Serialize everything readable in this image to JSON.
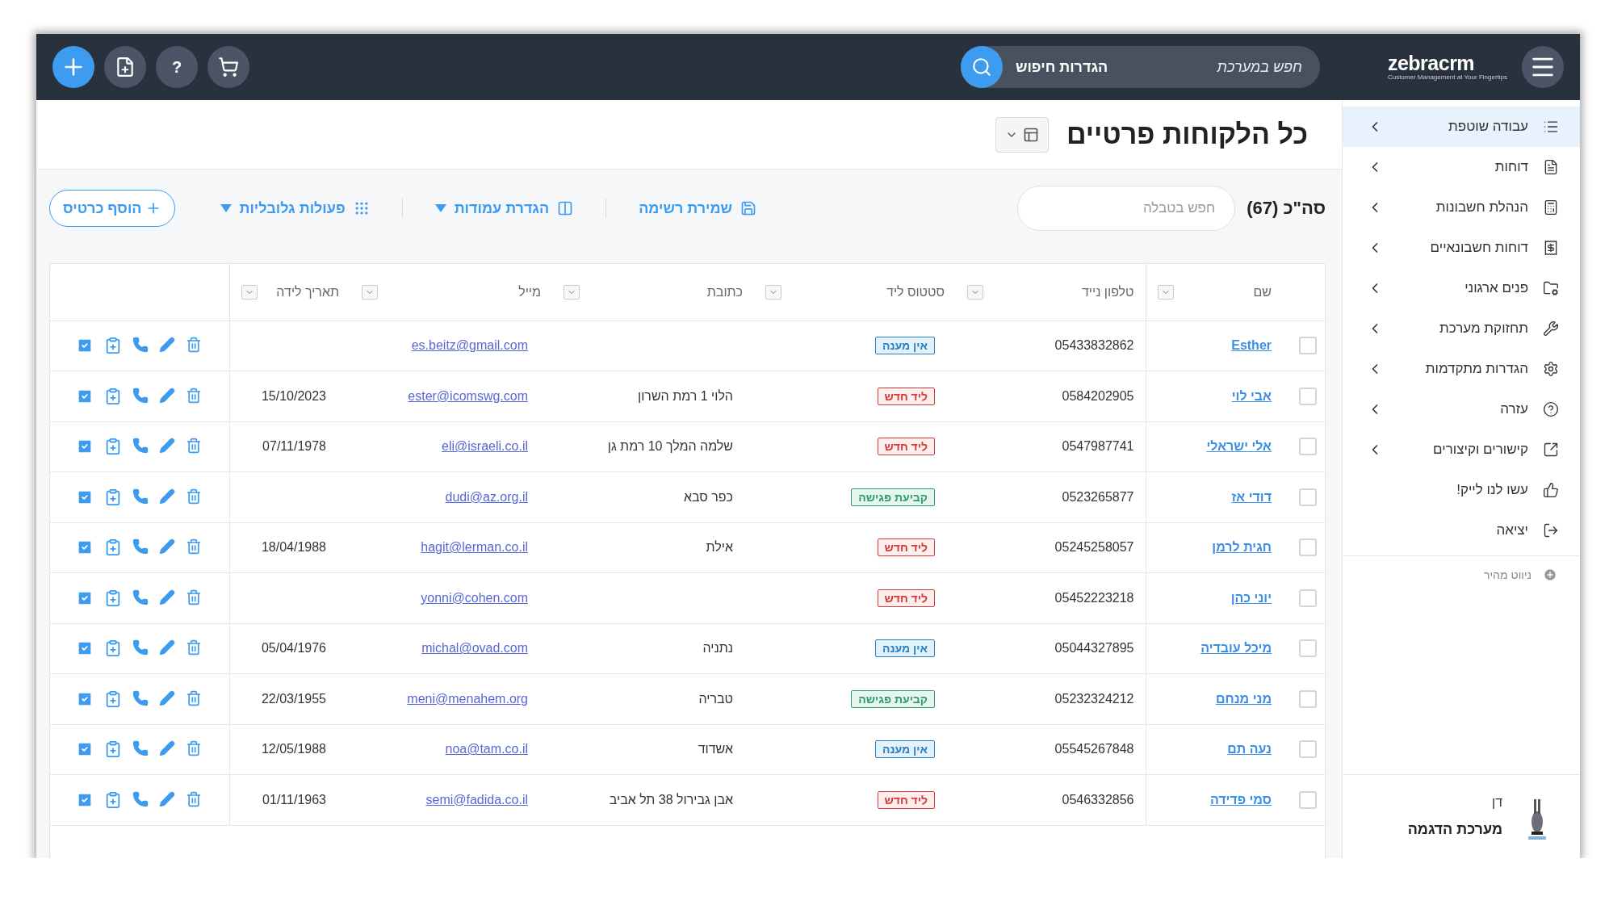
{
  "topbar": {
    "logo": "zebracrm",
    "tagline": "Customer Management at Your Fingertips",
    "search": {
      "placeholder": "חפש במערכת",
      "settings_label": "הגדרות חיפוש"
    },
    "help_button": "?"
  },
  "sidebar": {
    "items": [
      {
        "label": "עבודה שוטפת",
        "selected": true,
        "has_submenu": true
      },
      {
        "label": "דוחות",
        "selected": false,
        "has_submenu": true
      },
      {
        "label": "הנהלת חשבונות",
        "selected": false,
        "has_submenu": true
      },
      {
        "label": "דוחות חשבונאיים",
        "selected": false,
        "has_submenu": true
      },
      {
        "label": "פנים ארגוני",
        "selected": false,
        "has_submenu": true
      },
      {
        "label": "תחזוקת מערכת",
        "selected": false,
        "has_submenu": true
      },
      {
        "label": "הגדרות מתקדמות",
        "selected": false,
        "has_submenu": true
      },
      {
        "label": "עזרה",
        "selected": false,
        "has_submenu": true
      },
      {
        "label": "קישורים וקיצורים",
        "selected": false,
        "has_submenu": true
      },
      {
        "label": "עשו לנו לייק!",
        "selected": false,
        "has_submenu": false
      },
      {
        "label": "יציאה",
        "selected": false,
        "has_submenu": false
      }
    ],
    "quick_nav": "ניווט מהיר",
    "user": {
      "name": "דן",
      "company": "מערכת הדגמה"
    }
  },
  "page": {
    "title": "כל הלקוחות פרטיים",
    "total": "סה\"כ (67)",
    "table_search": {
      "placeholder": "חפש בטבלה"
    },
    "actions": [
      {
        "label": "שמירת רשימה",
        "kind": "save"
      },
      {
        "label": "הגדרת עמודות",
        "kind": "columns"
      },
      {
        "label": "פעולות גלובליות",
        "kind": "global"
      }
    ],
    "add_button": "הוסף כרטיס"
  },
  "table": {
    "columns": [
      "שם",
      "טלפון נייד",
      "סטטוס ליד",
      "כתובת",
      "מייל",
      "תאריך לידה"
    ],
    "rows": [
      {
        "checked": false,
        "name": "Esther",
        "phone": "05433832862",
        "status": {
          "label": "אין מענה",
          "kind": "no_answer"
        },
        "email": "es.beitz@gmail.com"
      },
      {
        "checked": false,
        "name": "אבי לוי",
        "phone": "0584202905",
        "status": {
          "label": "ליד חדש",
          "kind": "new_lead"
        },
        "address": "הלוי 1 רמת השרון",
        "email": "ester@icomswg.com",
        "birth_date": "15/10/2023"
      },
      {
        "checked": false,
        "name": "אלי ישראלי",
        "phone": "0547987741",
        "status": {
          "label": "ליד חדש",
          "kind": "new_lead"
        },
        "address": "שלמה המלך 10 רמת גן",
        "email": "eli@israeli.co.il",
        "birth_date": "07/11/1978"
      },
      {
        "checked": false,
        "name": "דודי אז",
        "phone": "0523265877",
        "status": {
          "label": "קביעת פגישה",
          "kind": "meeting"
        },
        "address": "כפר סבא",
        "email": "dudi@az.org.il"
      },
      {
        "checked": false,
        "name": "חגית לרמן",
        "phone": "05245258057",
        "status": {
          "label": "ליד חדש",
          "kind": "new_lead"
        },
        "address": "אילת",
        "email": "hagit@lerman.co.il",
        "birth_date": "18/04/1988"
      },
      {
        "checked": false,
        "name": "יוני כהן",
        "phone": "05452223218",
        "status": {
          "label": "ליד חדש",
          "kind": "new_lead"
        },
        "email": "yonni@cohen.com"
      },
      {
        "checked": false,
        "name": "מיכל עובדיה",
        "phone": "05044327895",
        "status": {
          "label": "אין מענה",
          "kind": "no_answer"
        },
        "address": "נתניה",
        "email": "michal@ovad.com",
        "birth_date": "05/04/1976"
      },
      {
        "checked": false,
        "name": "מני מנחם",
        "phone": "05232324212",
        "status": {
          "label": "קביעת פגישה",
          "kind": "meeting"
        },
        "address": "טבריה",
        "email": "meni@menahem.org",
        "birth_date": "22/03/1955"
      },
      {
        "checked": false,
        "name": "נעה תם",
        "phone": "05545267848",
        "status": {
          "label": "אין מענה",
          "kind": "no_answer"
        },
        "address": "אשדוד",
        "email": "noa@tam.co.il",
        "birth_date": "12/05/1988"
      },
      {
        "checked": false,
        "name": "סמי פדידה",
        "phone": "0546332856",
        "status": {
          "label": "ליד חדש",
          "kind": "new_lead"
        },
        "address": "אבן גבירול 38 תל אביב",
        "email": "semi@fadida.co.il",
        "birth_date": "01/11/1963"
      }
    ]
  }
}
